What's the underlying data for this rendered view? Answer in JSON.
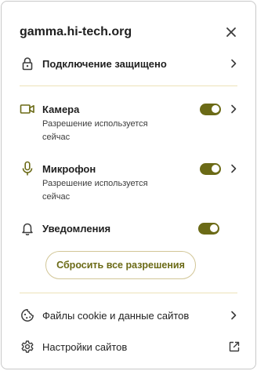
{
  "header": {
    "site": "gamma.hi-tech.org",
    "close_icon": "close-icon"
  },
  "connection": {
    "label": "Подключение защищено",
    "icon": "lock-icon"
  },
  "permissions": [
    {
      "label": "Камера",
      "status": "Разрешение используется сейчас",
      "enabled": true,
      "icon": "camera-icon"
    },
    {
      "label": "Микрофон",
      "status": "Разрешение используется сейчас",
      "enabled": true,
      "icon": "microphone-icon"
    },
    {
      "label": "Уведомления",
      "enabled": true,
      "icon": "bell-icon"
    }
  ],
  "reset_label": "Сбросить все разрешения",
  "footer": {
    "cookies_label": "Файлы cookie и данные сайтов",
    "cookies_icon": "cookie-icon",
    "settings_label": "Настройки сайтов",
    "settings_icon": "gear-icon",
    "external_icon": "open-in-new-icon"
  },
  "colors": {
    "accent": "#6b6a16",
    "divider": "#ece2b8",
    "icon_accent": "#6b6a16",
    "text": "#1f1f1f"
  }
}
